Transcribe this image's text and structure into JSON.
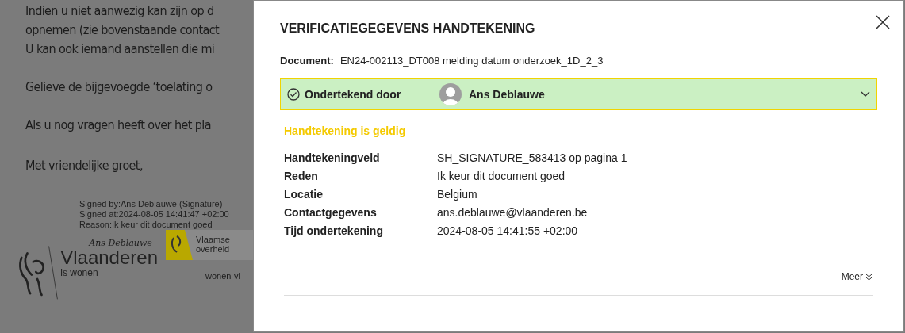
{
  "document_background": {
    "paragraphs": [
      "Indien u niet aanwezig kan zijn op d",
      "opnemen (zie bovenstaande contact",
      "U kan ook iemand aanstellen die mi",
      "Gelieve de bijgevoegde ‘toelating o",
      "Als u nog vragen heeft over het pla",
      "Met vriendelijke groet,"
    ],
    "signature_stamp": [
      "Signed by:Ans Deblauwe (Signature)",
      "Signed at:2024-08-05 14:41:47 +02:00",
      "Reason:Ik keur dit document goed"
    ],
    "handwritten_signature": "Ans Deblauwe",
    "logo_name": "Vlaanderen",
    "logo_tagline": "is wonen",
    "badge_lines": [
      "Vlaamse",
      "overheid"
    ],
    "website": "wonen-vl"
  },
  "dialog": {
    "title": "VERIFICATIEGEGEVENS HANDTEKENING",
    "document_label": "Document:",
    "document_name": "EN24-002113_DT008 melding datum onderzoek_1D_2_3",
    "signer_panel": {
      "label": "Ondertekend door",
      "name": "Ans Deblauwe",
      "expanded": false
    },
    "status": "Handtekening is geldig",
    "details": [
      {
        "label": "Handtekeningveld",
        "value": "SH_SIGNATURE_583413 op pagina 1"
      },
      {
        "label": "Reden",
        "value": "Ik keur dit document goed"
      },
      {
        "label": "Locatie",
        "value": "Belgium"
      },
      {
        "label": "Contactgegevens",
        "value": "ans.deblauwe@vlaanderen.be"
      },
      {
        "label": "Tijd ondertekening",
        "value": "2024-08-05 14:41:55 +02:00"
      }
    ],
    "more_link": "Meer"
  }
}
